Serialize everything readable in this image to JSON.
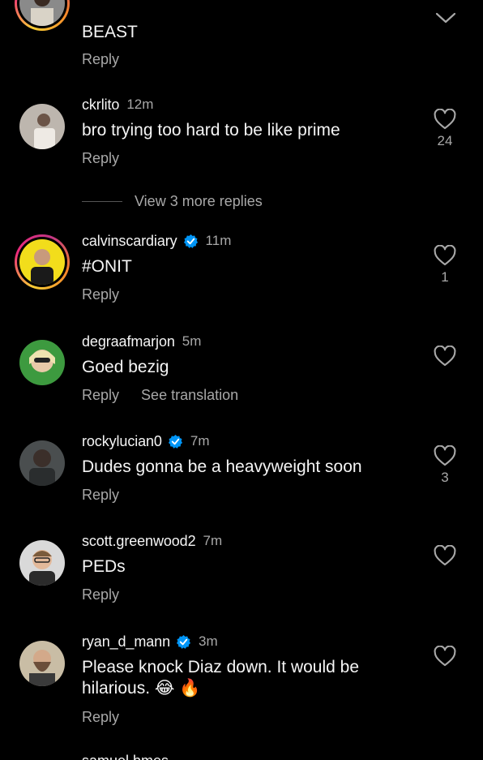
{
  "top_partial": {
    "text": "BEAST",
    "reply_label": "Reply"
  },
  "comments": [
    {
      "username": "ckrlito",
      "time": "12m",
      "verified": false,
      "text": "bro trying too hard to be like prime",
      "reply_label": "Reply",
      "likes": "24"
    },
    {
      "username": "calvinscardiary",
      "time": "11m",
      "verified": true,
      "text": "#ONIT",
      "reply_label": "Reply",
      "likes": "1"
    },
    {
      "username": "degraafmarjon",
      "time": "5m",
      "verified": false,
      "text": "Goed bezig",
      "reply_label": "Reply",
      "translation_label": "See translation",
      "likes": ""
    },
    {
      "username": "rockylucian0",
      "time": "7m",
      "verified": true,
      "text": "Dudes gonna be a heavyweight soon",
      "reply_label": "Reply",
      "likes": "3"
    },
    {
      "username": "scott.greenwood2",
      "time": "7m",
      "verified": false,
      "text": "PEDs",
      "reply_label": "Reply",
      "likes": ""
    },
    {
      "username": "ryan_d_mann",
      "time": "3m",
      "verified": true,
      "text": "Please knock Diaz down. It would be hilarious. 😂 🔥",
      "reply_label": "Reply",
      "likes": ""
    }
  ],
  "more_replies_label": "View 3 more replies",
  "cutoff_username": "samuel.bmes",
  "icons": {
    "like": "heart-outline-icon",
    "verified": "verified-badge-icon",
    "collapse": "chevron-down-icon"
  },
  "colors": {
    "background": "#000000",
    "primary_text": "#f5f5f5",
    "secondary_text": "#a8a8a8",
    "verified_blue": "#0095f6"
  }
}
